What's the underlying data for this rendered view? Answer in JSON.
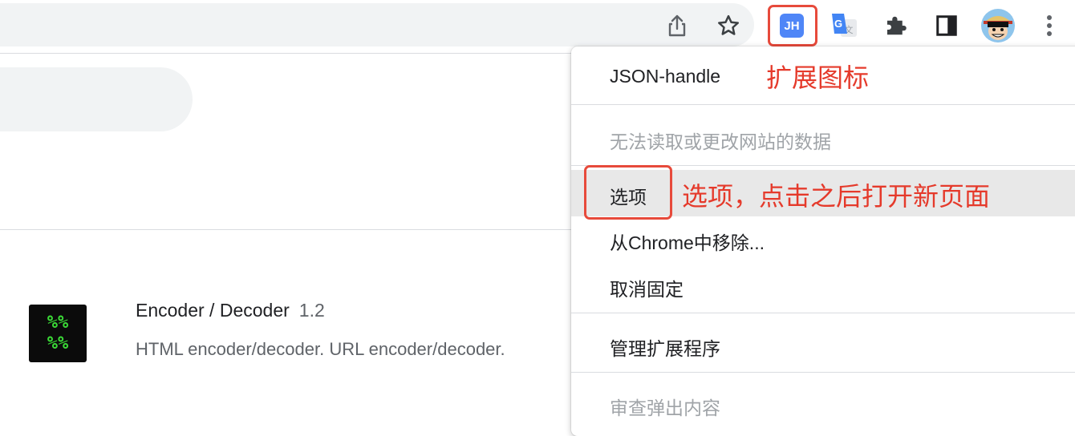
{
  "toolbar": {
    "extension_badge_text": "JH",
    "icons": [
      "share-icon",
      "star-icon",
      "json-handle-extension-icon",
      "google-translate-icon",
      "puzzle-icon",
      "side-panel-icon",
      "avatar",
      "kebab-menu-icon"
    ],
    "accent": "#4f86f7"
  },
  "extension_card": {
    "icon_text_line1": "%%",
    "icon_text_line2": "%%",
    "name": "Encoder / Decoder",
    "version": "1.2",
    "description": "HTML encoder/decoder. URL encoder/decoder."
  },
  "menu": {
    "title": "JSON-handle",
    "site_access": "无法读取或更改网站的数据",
    "options": "选项",
    "remove": "从Chrome中移除...",
    "unpin": "取消固定",
    "manage": "管理扩展程序",
    "inspect_popup": "审查弹出内容"
  },
  "annotations": {
    "icon_note": "扩展图标",
    "options_note": "选项，点击之后打开新页面",
    "color": "#e53a2b"
  }
}
